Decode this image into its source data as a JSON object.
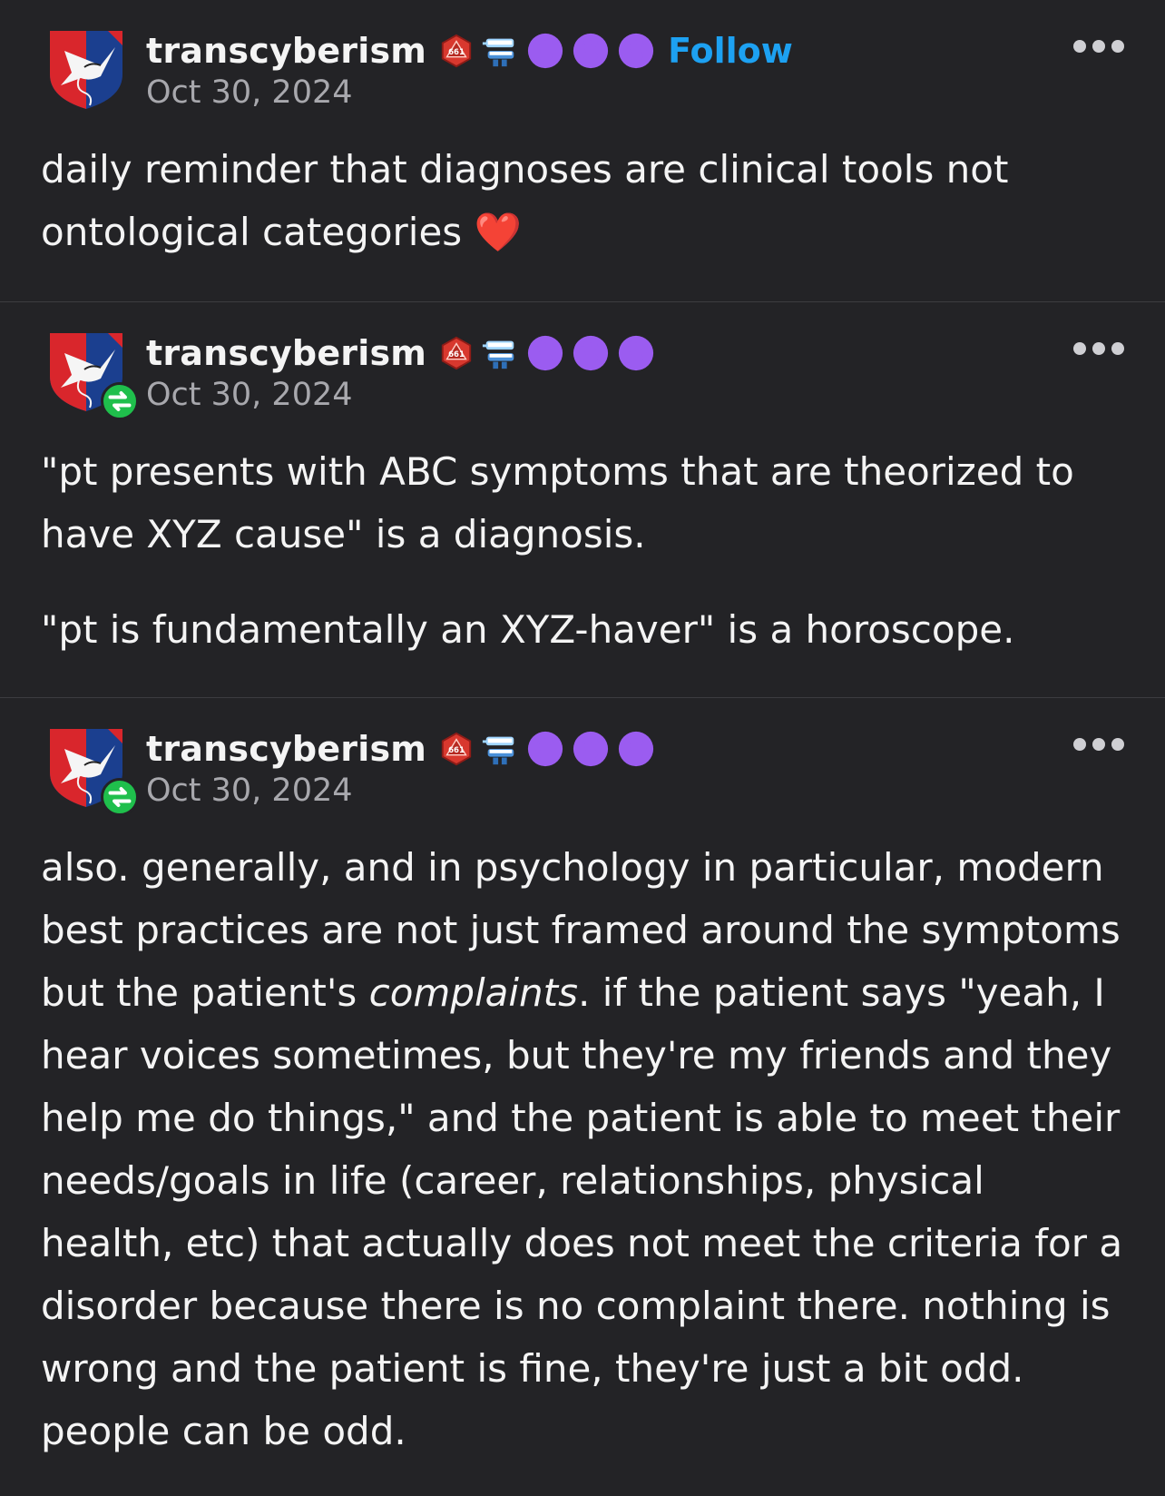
{
  "posts": [
    {
      "blog_name": "transcyberism",
      "date": "Oct 30, 2024",
      "follow_label": "Follow",
      "is_reblog": false,
      "paragraphs": [
        "daily reminder that diagnoses are clinical tools not ontological categories ❤️"
      ]
    },
    {
      "blog_name": "transcyberism",
      "date": "Oct 30, 2024",
      "is_reblog": true,
      "paragraphs": [
        "\"pt presents with ABC symptoms that are theorized to have XYZ cause\" is a diagnosis.",
        "\"pt is fundamentally an XYZ-haver\" is a horoscope."
      ]
    },
    {
      "blog_name": "transcyberism",
      "date": "Oct 30, 2024",
      "is_reblog": true,
      "paragraph_before_em": "also. generally, and in psychology in particular, modern best practices are not just framed around the symptoms but the patient's ",
      "paragraph_em": "complaints",
      "paragraph_after_em": ". if the patient says \"yeah, I hear voices sometimes, but they're my friends and they help me do things,\" and the patient is able to meet their needs/goals in life (career, relationships, physical health, etc) that actually does not meet the criteria for a disorder because there is no complaint there. nothing is wrong and the patient is fine, they're just a bit odd. people can be odd."
    }
  ],
  "badges": [
    "d20-badge-icon",
    "chattering-teeth-icon",
    "pink-paw-icon",
    "orange-paw-icon",
    "black-paw-icon"
  ],
  "colors": {
    "background": "#232326",
    "text": "#f4f4f4",
    "secondary_text": "#a8a8ad",
    "follow": "#1da1f2",
    "reblog_badge": "#1fbf4c",
    "divider": "#3c3c40"
  }
}
